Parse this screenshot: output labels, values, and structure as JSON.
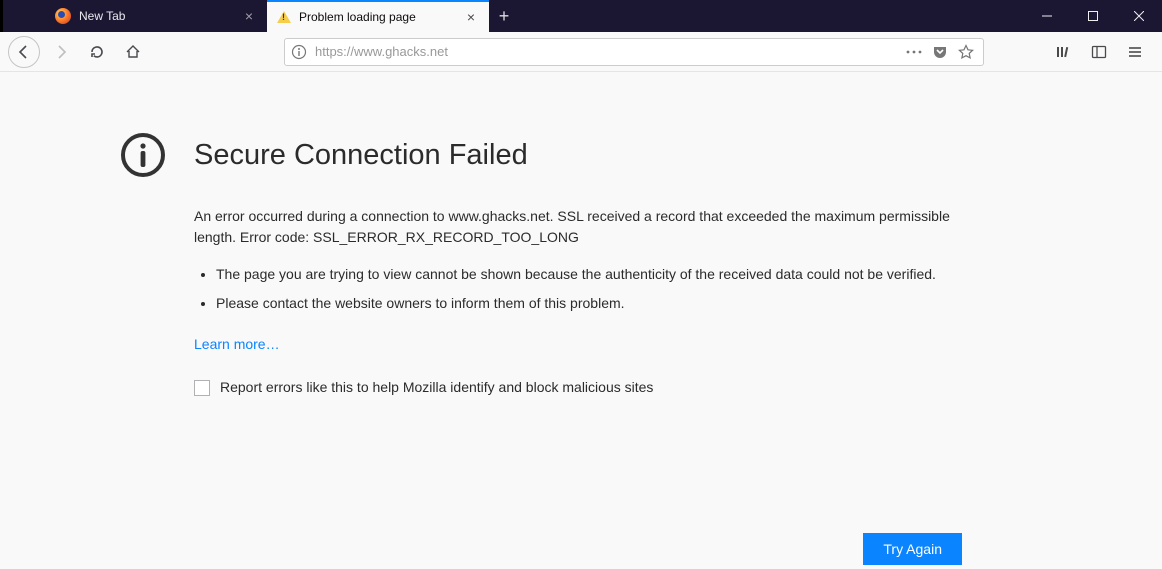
{
  "tabs": [
    {
      "label": "New Tab",
      "active": false
    },
    {
      "label": "Problem loading page",
      "active": true
    }
  ],
  "urlbar": {
    "url": "https://www.ghacks.net"
  },
  "error": {
    "title": "Secure Connection Failed",
    "description": "An error occurred during a connection to www.ghacks.net. SSL received a record that exceeded the maximum permissible length. Error code: SSL_ERROR_RX_RECORD_TOO_LONG",
    "bullets": [
      "The page you are trying to view cannot be shown because the authenticity of the received data could not be verified.",
      "Please contact the website owners to inform them of this problem."
    ],
    "learn_more": "Learn more…",
    "report_label": "Report errors like this to help Mozilla identify and block malicious sites",
    "try_again": "Try Again"
  }
}
